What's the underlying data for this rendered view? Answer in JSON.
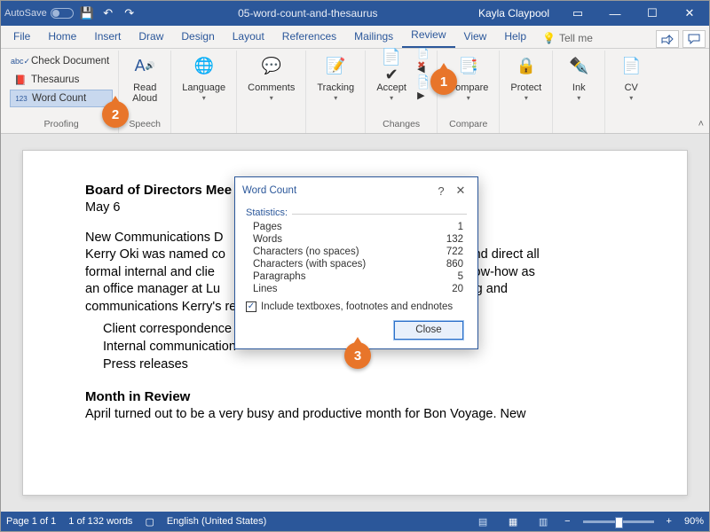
{
  "titlebar": {
    "autosave_label": "AutoSave",
    "doc_title": "05-word-count-and-thesaurus",
    "user": "Kayla Claypool"
  },
  "tabs": [
    "File",
    "Home",
    "Insert",
    "Draw",
    "Design",
    "Layout",
    "References",
    "Mailings",
    "Review",
    "View",
    "Help"
  ],
  "active_tab": "Review",
  "tell_me": "Tell me",
  "ribbon": {
    "proofing": {
      "label": "Proofing",
      "check_doc": "Check Document",
      "thesaurus": "Thesaurus",
      "word_count": "Word Count"
    },
    "speech": {
      "label": "Speech",
      "read_aloud": "Read\nAloud"
    },
    "language": {
      "label": "Language"
    },
    "comments": {
      "label": "Comments"
    },
    "tracking": {
      "label": "Tracking"
    },
    "changes": {
      "label": "Changes",
      "accept": "Accept"
    },
    "compare": {
      "label": "Compare",
      "compare_btn": "Compare"
    },
    "protect": {
      "label": "Protect"
    },
    "ink": {
      "label": "Ink"
    },
    "cv": {
      "label": "CV"
    }
  },
  "document": {
    "heading1": "Board of Directors Mee",
    "date": "May 6",
    "para1_l1": "New Communications D",
    "para1_l2": "Kerry Oki was named co",
    "para1_l2b": "dinate and direct all",
    "para1_l3": "formal internal and clie",
    "para1_l3b": "ars of know-how as",
    "para1_l4": "an office manager at Lu",
    "para1_l4b": "arketing and",
    "para1_l5": "communications Kerry's responsibilities will include:",
    "bullet1": "Client correspondence",
    "bullet2": "Internal communication",
    "bullet3": "Press releases",
    "heading2": "Month in Review",
    "para2": "April turned out to be a very busy and productive month for Bon Voyage. New"
  },
  "dialog": {
    "title": "Word Count",
    "stats_label": "Statistics:",
    "rows": [
      {
        "k": "Pages",
        "v": "1"
      },
      {
        "k": "Words",
        "v": "132"
      },
      {
        "k": "Characters (no spaces)",
        "v": "722"
      },
      {
        "k": "Characters (with spaces)",
        "v": "860"
      },
      {
        "k": "Paragraphs",
        "v": "5"
      },
      {
        "k": "Lines",
        "v": "20"
      }
    ],
    "checkbox": "Include textboxes, footnotes and endnotes",
    "close": "Close"
  },
  "status": {
    "page": "Page 1 of 1",
    "words": "1 of 132 words",
    "lang": "English (United States)",
    "zoom": "90%"
  },
  "callouts": {
    "c1": "1",
    "c2": "2",
    "c3": "3"
  }
}
